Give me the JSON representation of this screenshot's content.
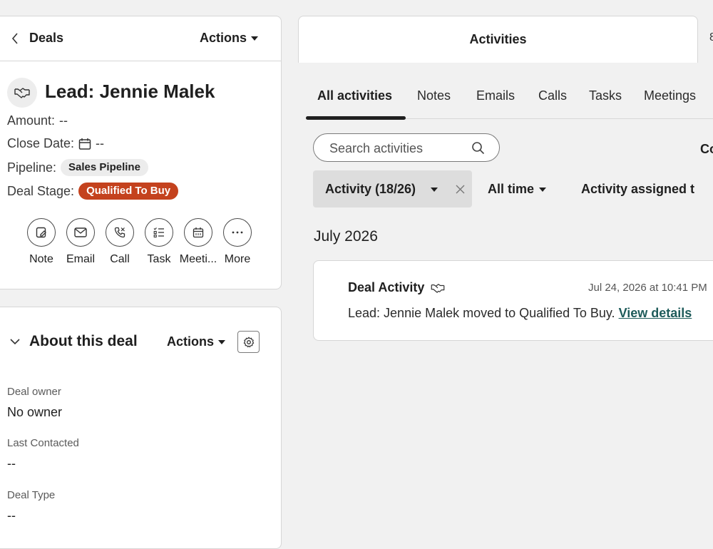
{
  "left": {
    "back_label": "Deals",
    "actions_label": "Actions",
    "title": "Lead: Jennie Malek",
    "amount_label": "Amount:",
    "amount_value": "--",
    "close_date_label": "Close Date:",
    "close_date_value": "--",
    "pipeline_label": "Pipeline:",
    "pipeline_value": "Sales Pipeline",
    "stage_label": "Deal Stage:",
    "stage_value": "Qualified To Buy",
    "stage_color": "#c4421e",
    "quick_actions": [
      {
        "label": "Note",
        "icon": "note-edit-icon"
      },
      {
        "label": "Email",
        "icon": "envelope-icon"
      },
      {
        "label": "Call",
        "icon": "phone-icon"
      },
      {
        "label": "Task",
        "icon": "checklist-icon"
      },
      {
        "label": "Meeti...",
        "icon": "calendar-icon"
      },
      {
        "label": "More",
        "icon": "more-dots-icon"
      }
    ]
  },
  "about": {
    "title": "About this deal",
    "actions_label": "Actions",
    "properties": [
      {
        "label": "Deal owner",
        "value": "No owner"
      },
      {
        "label": "Last Contacted",
        "value": "--"
      },
      {
        "label": "Deal Type",
        "value": "--"
      }
    ]
  },
  "right": {
    "tab_title": "Activities",
    "next_tab_fragment": "8",
    "sub_tabs": [
      "All activities",
      "Notes",
      "Emails",
      "Calls",
      "Tasks",
      "Meetings"
    ],
    "search_placeholder": "Search activities",
    "collapse_fragment": "Co",
    "filter_activity": "Activity (18/26)",
    "filter_time": "All time",
    "filter_assigned": "Activity assigned t",
    "month_heading": "July 2026",
    "activity": {
      "title": "Deal Activity",
      "timestamp": "Jul 24, 2026 at 10:41 PM",
      "body": "Lead: Jennie Malek moved to Qualified To Buy.",
      "link": "View details"
    }
  },
  "colors": {
    "link": "#1e5b5a",
    "background": "#f1f1f1"
  }
}
